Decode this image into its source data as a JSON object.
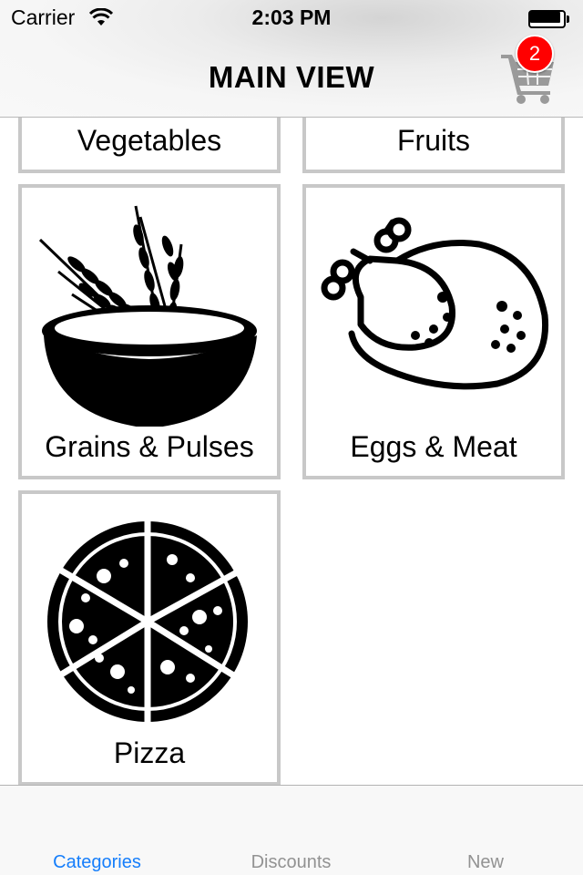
{
  "status_bar": {
    "carrier": "Carrier",
    "time": "2:03 PM",
    "wifi_icon": "wifi-icon",
    "battery_icon": "battery-icon"
  },
  "nav_bar": {
    "title": "MAIN VIEW",
    "cart_icon": "shopping-cart-icon",
    "cart_badge": "2",
    "badge_color": "#ff0000"
  },
  "categories": [
    {
      "label": "Vegetables",
      "icon": "vegetables-icon"
    },
    {
      "label": "Fruits",
      "icon": "fruits-icon"
    },
    {
      "label": "Grains & Pulses",
      "icon": "wheat-bowl-icon"
    },
    {
      "label": "Eggs & Meat",
      "icon": "roast-chicken-icon"
    },
    {
      "label": "Pizza",
      "icon": "pizza-icon"
    }
  ],
  "tab_bar": {
    "active_color": "#157efb",
    "inactive_color": "#929292",
    "tabs": [
      {
        "label": "Categories",
        "active": true
      },
      {
        "label": "Discounts",
        "active": false
      },
      {
        "label": "New",
        "active": false
      }
    ]
  }
}
